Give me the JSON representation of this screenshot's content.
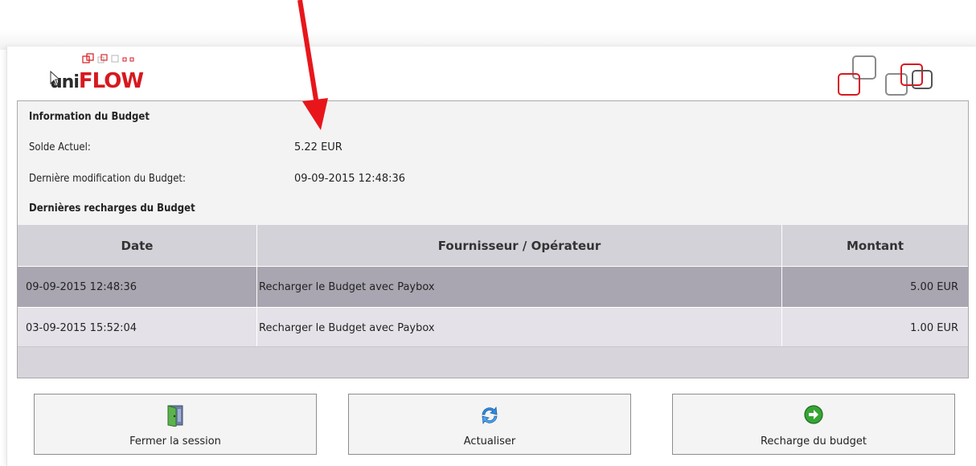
{
  "logo": {
    "uni": "uni",
    "flow": "FLOW"
  },
  "info": {
    "heading": "Information du Budget",
    "balance_label": "Solde Actuel:",
    "balance_value": "5.22 EUR",
    "last_modified_label": "Dernière modification du Budget:",
    "last_modified_value": "09-09-2015 12:48:36",
    "recharges_heading": "Dernières recharges du Budget"
  },
  "table": {
    "columns": [
      "Date",
      "Fournisseur / Opérateur",
      "Montant"
    ],
    "rows": [
      {
        "date": "09-09-2015 12:48:36",
        "provider": "Recharger le Budget avec Paybox",
        "amount": "5.00 EUR",
        "selected": true
      },
      {
        "date": "03-09-2015 15:52:04",
        "provider": "Recharger le Budget avec Paybox",
        "amount": "1.00 EUR",
        "selected": false
      }
    ]
  },
  "buttons": {
    "logout": {
      "label": "Fermer la session",
      "icon": "exit-door-icon"
    },
    "refresh": {
      "label": "Actualiser",
      "icon": "refresh-arrows-icon"
    },
    "recharge": {
      "label": "Recharge du budget",
      "icon": "green-arrow-right-icon"
    }
  },
  "colors": {
    "brand_red": "#d7191f",
    "annotation_arrow": "#e8161b",
    "selected_row": "#a9a6b1",
    "normal_row": "#e4e2e8",
    "header_row": "#d3d2d8"
  }
}
